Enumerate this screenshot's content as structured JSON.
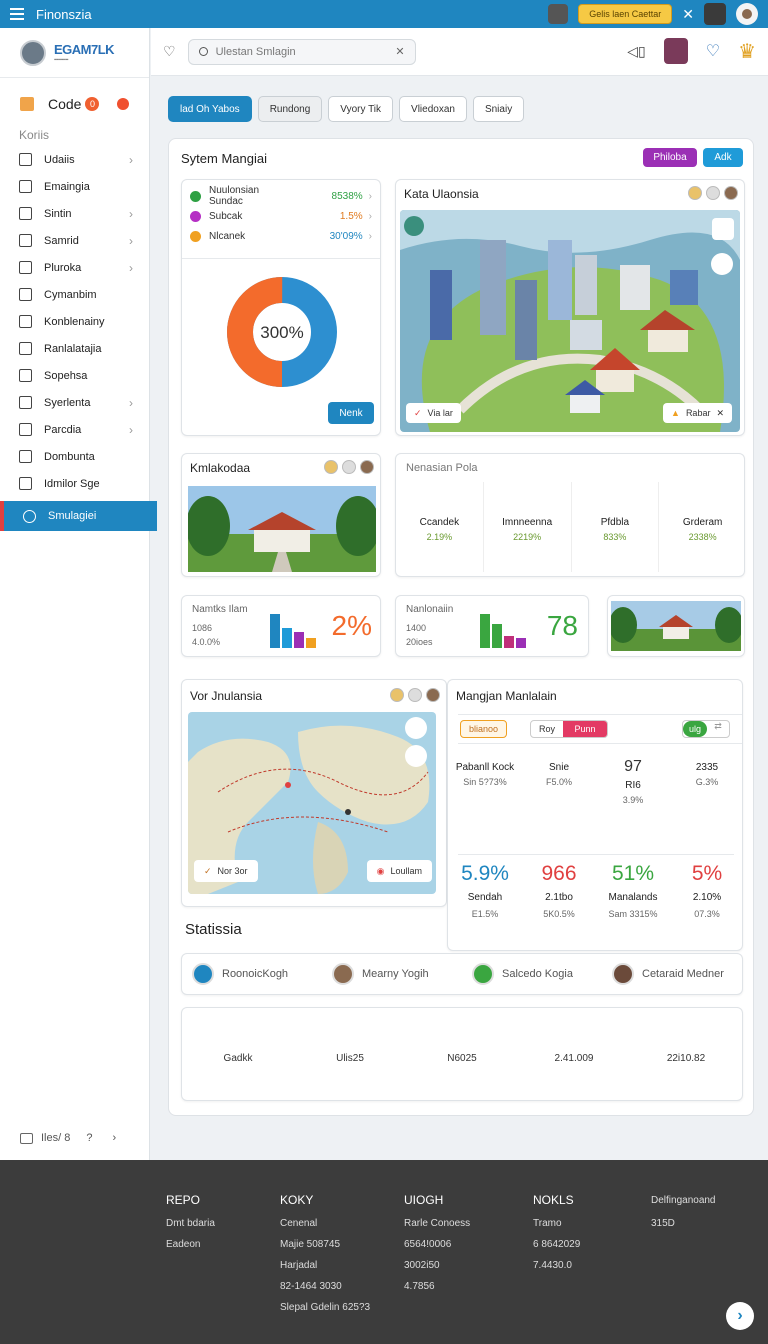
{
  "app": {
    "title": "Finonszia",
    "top_button": "Gelis laen Caettar"
  },
  "sidebar": {
    "logo": "EGAM7LK",
    "code_label": "Code",
    "code_badge": "0",
    "section": "Koriis",
    "items": [
      {
        "label": "Udaiis",
        "chev": true
      },
      {
        "label": "Emaingia",
        "chev": false
      },
      {
        "label": "Sintin",
        "chev": true
      },
      {
        "label": "Samrid",
        "chev": true
      },
      {
        "label": "Pluroka",
        "chev": true
      },
      {
        "label": "Cymanbim",
        "chev": false
      },
      {
        "label": "Konblenainy",
        "chev": false
      },
      {
        "label": "Ranlalatajia",
        "chev": false
      },
      {
        "label": "Sopehsa",
        "chev": false
      },
      {
        "label": "Syerlenta",
        "chev": true
      },
      {
        "label": "Parcdia",
        "chev": true
      },
      {
        "label": "Dombunta",
        "chev": false
      },
      {
        "label": "Idmilor Sge",
        "chev": false
      }
    ],
    "active_item": "Smulagiei",
    "footer_label": "Iles/ 8"
  },
  "header": {
    "search_placeholder": "Ulestan Smlagin"
  },
  "chips": [
    "lad Oh Yabos",
    "Rundong",
    "Vyory Tik",
    "Vliedoxan",
    "Sniaiy"
  ],
  "main": {
    "title": "Sytem Mangiai",
    "btn1": "Philoba",
    "btn2": "Adk",
    "stats": [
      {
        "label": "Nuulonsian Sundac",
        "value": "8538%",
        "color": "#2ea043",
        "vcolor": "#2ea043"
      },
      {
        "label": "Subcak",
        "value": "1.5%",
        "color": "#b52fc4",
        "vcolor": "#e07a1f"
      },
      {
        "label": "Nlcanek",
        "value": "30'09%",
        "color": "#f0a020",
        "vcolor": "#1f86c0"
      }
    ],
    "donut": {
      "label": "300%",
      "orange_fraction": 0.5,
      "colors": {
        "a": "#f36b2c",
        "b": "#2d8fd0"
      }
    },
    "next_button": "Nenk",
    "city": {
      "title": "Kata Ulaonsia",
      "tag_left": "Via lar",
      "tag_right": "Rabar"
    },
    "building": {
      "title": "Kmlakodaa"
    },
    "nenasian": {
      "title": "Nenasian Pola",
      "items": [
        {
          "name": "Ccandek",
          "sub": "2.19%"
        },
        {
          "name": "Imnneenna",
          "sub": "2219%"
        },
        {
          "name": "Pfdbla",
          "sub": "833%"
        },
        {
          "name": "Grderam",
          "sub": "2338%"
        }
      ]
    },
    "metric1": {
      "title": "Namtks Ilam",
      "l1": "1086",
      "l2": "4.0.0%",
      "big": "2%",
      "color": "#f36b2c"
    },
    "metric2": {
      "title": "Nanlonaiin",
      "l1": "1400",
      "l2": "20ioes",
      "big": "78",
      "color": "#3aa640"
    },
    "map": {
      "title": "Vor Jnulansia",
      "tag_left": "Nor 3or",
      "tag_right": "Loullam"
    },
    "manage": {
      "title": "Mangjan Manlalain",
      "tab1": "blianoo",
      "tab2": "Roy",
      "tab3": "Punn",
      "toggle": "ulg",
      "kpis": [
        {
          "name": "Pabanll Kock",
          "sub": "Sin 5?73%"
        },
        {
          "name": "Snie",
          "sub": "F5.0%"
        },
        {
          "name": "RI6",
          "sub": "3.9%"
        },
        {
          "name": "2335",
          "sub": "G.3%"
        }
      ],
      "bigs": [
        {
          "val": "5.9%",
          "color": "#1f86c0",
          "name": "Sendah",
          "sub": "E1.5%"
        },
        {
          "val": "966",
          "color": "#e04040",
          "name": "2.1tbo",
          "sub": "5K0.5%"
        },
        {
          "val": "51%",
          "color": "#3aa640",
          "name": "Manalands",
          "sub": "Sam 3315%"
        },
        {
          "val": "5%",
          "color": "#e04040",
          "name": "2.10%",
          "sub": "07.3%"
        }
      ]
    },
    "statistia": {
      "title": "Statissia",
      "people": [
        "RoonoicKogh",
        "Mearny Yogih",
        "Salcedo Kogia",
        "Cetaraid Medner"
      ]
    },
    "bottom_icons": [
      {
        "label": "Gadkk"
      },
      {
        "label": "Ulis25"
      },
      {
        "label": "N6025"
      },
      {
        "label": "2.41.009"
      },
      {
        "label": "22i10.82"
      }
    ]
  },
  "footer": {
    "cols": [
      {
        "head": "REPO",
        "lines": [
          "Dmt bdaria",
          "Eadeon"
        ]
      },
      {
        "head": "KOKY",
        "lines": [
          "Cenenal",
          "Majie 508745",
          "Harjadal",
          "82-1464 3030",
          "Slepal Gdelin 625?3"
        ]
      },
      {
        "head": "UIOGH",
        "lines": [
          "Rarle Conoess",
          "6564!0006",
          "3002i50",
          "4.7856"
        ]
      },
      {
        "head": "NOKLS",
        "lines": [
          "Tramo",
          "6 8642029",
          "7.4430.0"
        ]
      },
      {
        "head": "Delfinganoand",
        "lines": [
          "315D"
        ]
      }
    ]
  }
}
